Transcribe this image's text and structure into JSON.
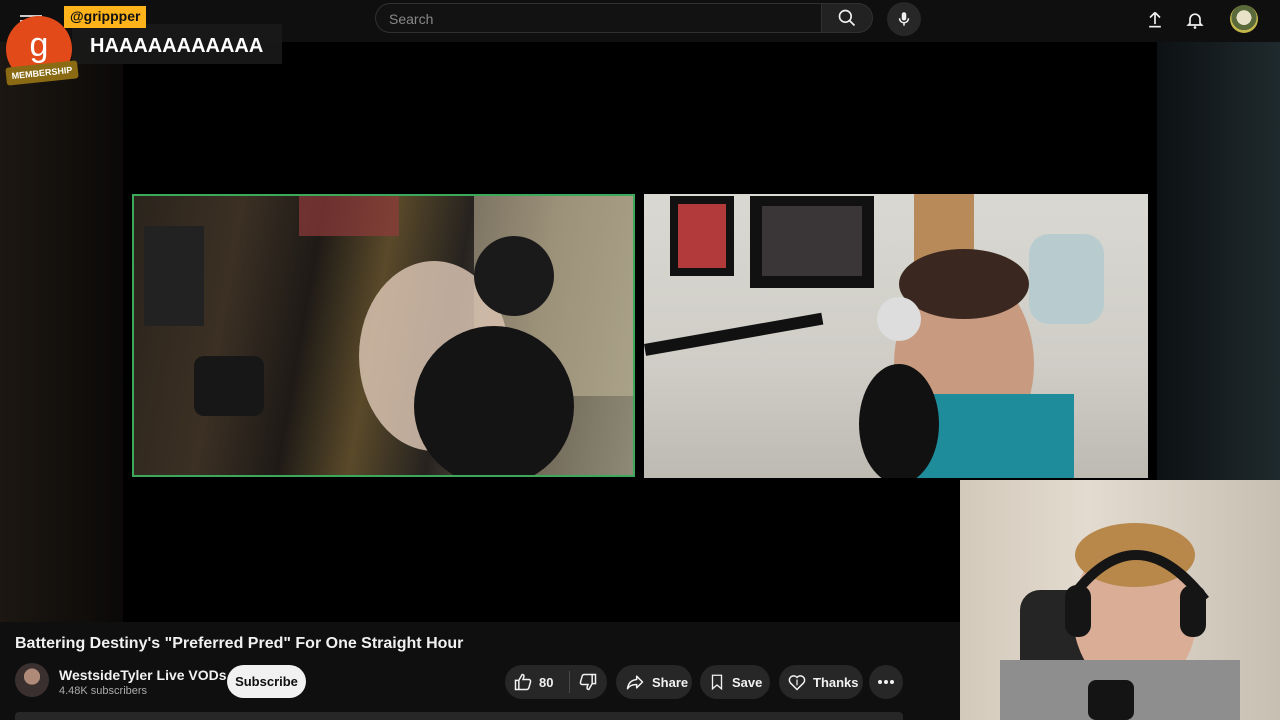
{
  "search": {
    "placeholder": "Search"
  },
  "chat": {
    "username": "@grippper",
    "avatar_letter": "g",
    "badge": "MEMBERSHIP",
    "message": "HAAAAAAAAAAA",
    "colors": {
      "username_bg": "#ffb31a",
      "avatar_bg": "#e24a1a"
    }
  },
  "video": {
    "title": "Battering Destiny's \"Preferred Pred\" For One Straight Hour"
  },
  "channel": {
    "name": "WestsideTyler Live VODs",
    "subscribers": "4.48K subscribers"
  },
  "actions": {
    "subscribe": "Subscribe",
    "like_count": "80",
    "share": "Share",
    "save": "Save",
    "thanks": "Thanks"
  },
  "icons": {
    "menu": "hamburger-icon",
    "search": "search-icon",
    "mic": "mic-icon",
    "upload": "upload-icon",
    "notifications": "bell-icon",
    "like": "thumbs-up-icon",
    "dislike": "thumbs-down-icon",
    "share": "share-arrow-icon",
    "save": "bookmark-icon",
    "thanks": "heart-dollar-icon",
    "more": "more-horizontal-icon"
  },
  "colors": {
    "page_bg": "#0f0f0f",
    "pill_bg": "#272727",
    "cam_border": "#3ea85a",
    "subscribe_bg": "#f1f1f1"
  }
}
